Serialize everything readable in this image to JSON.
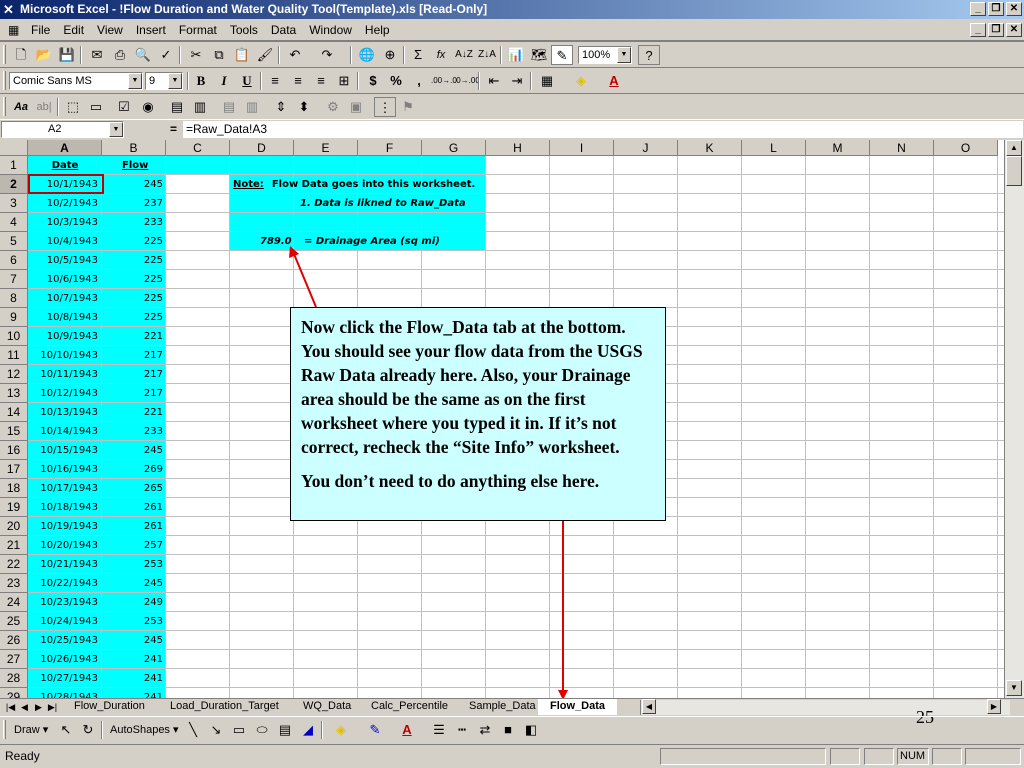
{
  "window": {
    "title": "Microsoft Excel - !Flow Duration and Water Quality Tool(Template).xls  [Read-Only]"
  },
  "menu": [
    "File",
    "Edit",
    "View",
    "Insert",
    "Format",
    "Tools",
    "Data",
    "Window",
    "Help"
  ],
  "toolbar": {
    "zoom": "100%",
    "font_name": "Comic Sans MS",
    "font_size": "9",
    "bold": "B",
    "italic": "I",
    "underline": "U",
    "currency": "$",
    "percent": "%",
    "comma": ",",
    "sigma": "Σ",
    "fx": "fx",
    "dec_inc": ".00→.0",
    "dec_dec": ".0→.00"
  },
  "formula_bar": {
    "name_box": "A2",
    "equals": "=",
    "formula": "=Raw_Data!A3"
  },
  "columns": [
    "A",
    "B",
    "C",
    "D",
    "E",
    "F",
    "G",
    "H",
    "I",
    "J",
    "K",
    "L",
    "M",
    "N",
    "O"
  ],
  "rows": [
    "1",
    "2",
    "3",
    "4",
    "5",
    "6",
    "7",
    "8",
    "9",
    "10",
    "11",
    "12",
    "13",
    "14",
    "15",
    "16",
    "17",
    "18",
    "19",
    "20",
    "21",
    "22",
    "23",
    "24",
    "25",
    "26",
    "27",
    "28",
    "29"
  ],
  "sheet": {
    "header_date": "Date",
    "header_flow": "Flow",
    "dates": [
      "10/1/1943",
      "10/2/1943",
      "10/3/1943",
      "10/4/1943",
      "10/5/1943",
      "10/6/1943",
      "10/7/1943",
      "10/8/1943",
      "10/9/1943",
      "10/10/1943",
      "10/11/1943",
      "10/12/1943",
      "10/13/1943",
      "10/14/1943",
      "10/15/1943",
      "10/16/1943",
      "10/17/1943",
      "10/18/1943",
      "10/19/1943",
      "10/20/1943",
      "10/21/1943",
      "10/22/1943",
      "10/23/1943",
      "10/24/1943",
      "10/25/1943",
      "10/26/1943",
      "10/27/1943",
      "10/28/1943"
    ],
    "flows": [
      "245",
      "237",
      "233",
      "225",
      "225",
      "225",
      "225",
      "225",
      "221",
      "217",
      "217",
      "217",
      "221",
      "233",
      "245",
      "269",
      "265",
      "261",
      "261",
      "257",
      "253",
      "245",
      "249",
      "253",
      "245",
      "241",
      "241",
      "241"
    ],
    "note_label": "Note:",
    "note_text": "Flow Data goes into this worksheet.",
    "note_line2": "1. Data is likned to Raw_Data",
    "drainage_value": "789.0",
    "drainage_label": "= Drainage Area  (sq mi)"
  },
  "callout": {
    "para1": "Now click the Flow_Data tab at the bottom.  You should see your flow data from the USGS Raw Data already here.  Also, your Drainage area should be the same as on the first worksheet where you typed it in.  If it’s not correct, recheck the “Site Info” worksheet.",
    "para2": "You don’t need to do anything else here."
  },
  "tabs": [
    "Flow_Duration",
    "Load_Duration_Target",
    "WQ_Data",
    "Calc_Percentile",
    "Sample_Data",
    "Flow_Data"
  ],
  "active_tab": "Flow_Data",
  "page_number": "25",
  "draw_toolbar": {
    "draw": "Draw",
    "autoshapes": "AutoShapes"
  },
  "status": {
    "text": "Ready",
    "num": "NUM"
  },
  "colors": {
    "cyan_fill": "#00ffff",
    "callout_fill": "#ccffff",
    "arrow": "#e00000"
  }
}
